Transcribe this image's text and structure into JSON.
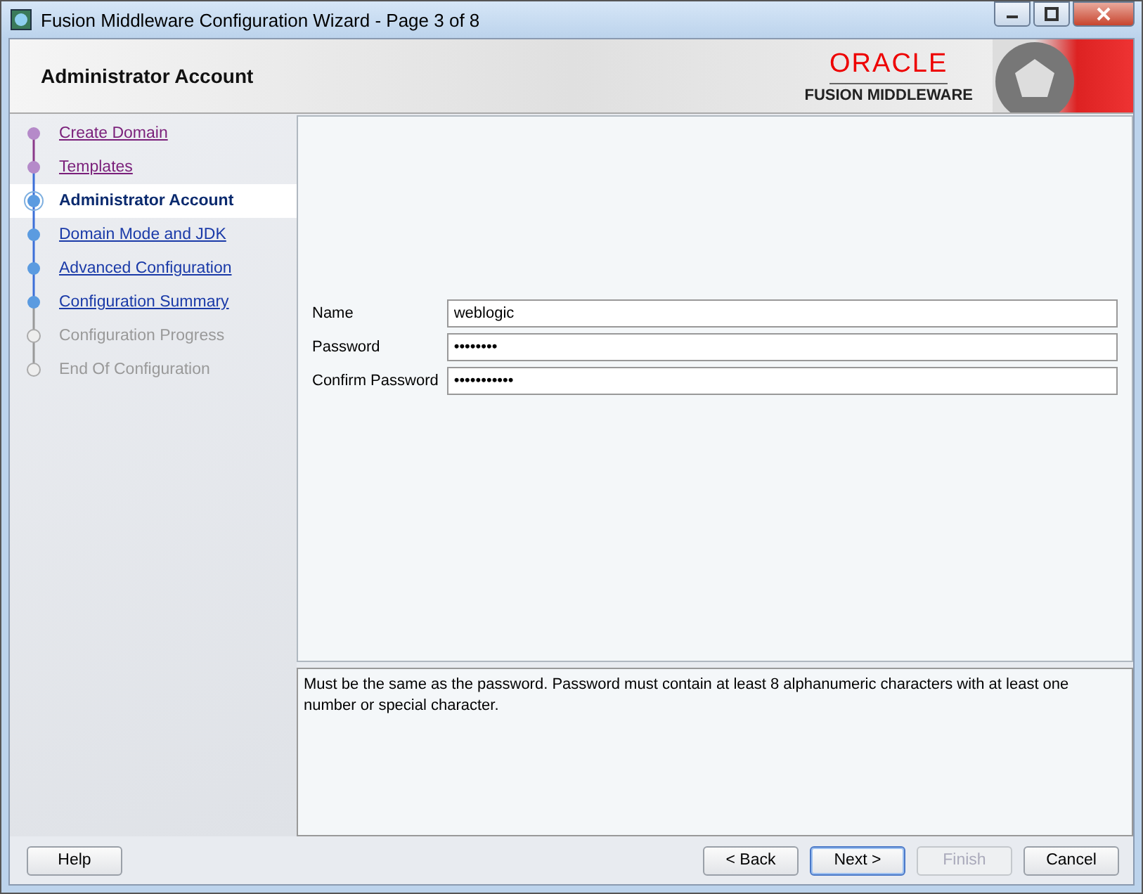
{
  "window": {
    "title": "Fusion Middleware Configuration Wizard - Page 3 of 8"
  },
  "header": {
    "title": "Administrator Account",
    "logo": "ORACLE",
    "logo_subtitle": "FUSION MIDDLEWARE"
  },
  "steps": [
    {
      "label": "Create Domain",
      "kind": "visited",
      "selected": false
    },
    {
      "label": "Templates",
      "kind": "visited",
      "selected": false
    },
    {
      "label": "Administrator Account",
      "kind": "current",
      "selected": true
    },
    {
      "label": "Domain Mode and JDK",
      "kind": "available",
      "selected": false
    },
    {
      "label": "Advanced Configuration",
      "kind": "available",
      "selected": false
    },
    {
      "label": "Configuration Summary",
      "kind": "available",
      "selected": false
    },
    {
      "label": "Configuration Progress",
      "kind": "disabled",
      "selected": false
    },
    {
      "label": "End Of Configuration",
      "kind": "disabled",
      "selected": false
    }
  ],
  "form": [
    {
      "label": "Name",
      "value": "weblogic"
    },
    {
      "label": "Password",
      "value": "••••••••"
    },
    {
      "label": "Confirm Password",
      "value": "•••••••••••"
    }
  ],
  "help_text": "Must be the same as the password. Password must contain at least 8 alphanumeric characters with at least one number or special character.",
  "buttons": {
    "help": {
      "label": "Help",
      "disabled": false
    },
    "actions": [
      {
        "label": "< Back",
        "disabled": false,
        "default": false
      },
      {
        "label": "Next >",
        "disabled": false,
        "default": true
      },
      {
        "label": "Finish",
        "disabled": true,
        "default": false
      },
      {
        "label": "Cancel",
        "disabled": false,
        "default": false
      }
    ]
  }
}
